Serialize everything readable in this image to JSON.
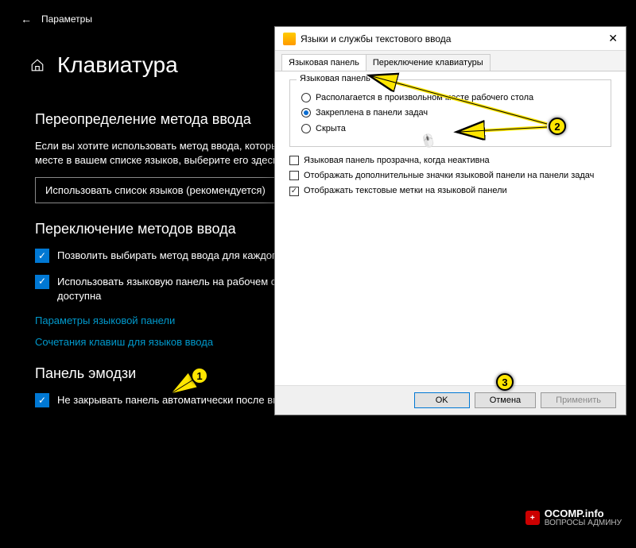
{
  "settings": {
    "window_title": "Параметры",
    "page_title": "Клавиатура",
    "section_override": "Переопределение метода ввода",
    "override_body": "Если вы хотите использовать метод ввода, который указан на первом месте в вашем списке языков, выберите его здесь",
    "dropdown_value": "Использовать список языков (рекомендуется)",
    "section_switch": "Переключение методов ввода",
    "cb_per_app": "Позволить выбирать метод ввода для каждого приложения",
    "cb_use_langbar": "Использовать языковую панель на рабочем столе, если она доступна",
    "link_langbar": "Параметры языковой панели",
    "link_hotkeys": "Сочетания клавиш для языков ввода",
    "section_emoji": "Панель эмодзи",
    "cb_emoji": "Не закрывать панель автоматически после ввода эмодзи"
  },
  "dialog": {
    "title": "Языки и службы текстового ввода",
    "tab_langbar": "Языковая панель",
    "tab_switch": "Переключение клавиатуры",
    "group_label": "Языковая панель",
    "radio_float": "Располагается в произвольном месте рабочего стола",
    "radio_docked": "Закреплена в панели задач",
    "radio_hidden": "Скрыта",
    "cb_transparent": "Языковая панель прозрачна, когда неактивна",
    "cb_extra_icons": "Отображать дополнительные значки языковой панели на панели задач",
    "cb_text_labels": "Отображать текстовые метки на языковой панели",
    "btn_ok": "OK",
    "btn_cancel": "Отмена",
    "btn_apply": "Применить"
  },
  "annotations": {
    "step1": "1",
    "step2": "2",
    "step3": "3"
  },
  "watermark": {
    "brand": "OCOMP.info",
    "sub": "ВОПРОСЫ АДМИНУ"
  }
}
